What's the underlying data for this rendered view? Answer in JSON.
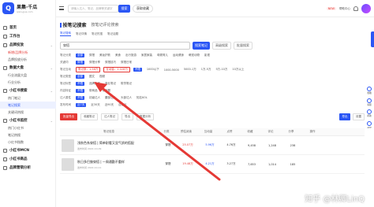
{
  "brand": {
    "name": "果集·千瓜",
    "sub": "qian-gua.com"
  },
  "sidebar": {
    "groups": [
      {
        "label": "首页",
        "items": []
      },
      {
        "label": "工作台",
        "items": []
      },
      {
        "label": "品牌投放",
        "items": [
          "新增/品牌分析",
          "品牌投放分析"
        ]
      },
      {
        "label": "数据大盘",
        "items": [
          "行业流量大盘",
          "行业分析"
        ]
      },
      {
        "label": "小红书搜索",
        "items": [
          "热门笔记",
          "笔记搜索",
          "关键词热搜"
        ]
      },
      {
        "label": "小红书监控",
        "items": [
          "热门小红书",
          "笔记热搜",
          "小红书指数"
        ]
      },
      {
        "label": "小红书MCN",
        "items": []
      },
      {
        "label": "小红书商品",
        "items": []
      },
      {
        "label": "品牌营销分析",
        "items": []
      }
    ]
  },
  "topbar": {
    "search_placeholder": "请输入达人、笔记、品牌等关键字",
    "search_btn": "搜索",
    "pill": "获取收藏",
    "right_text": "帮助中心",
    "badge": "NEW"
  },
  "main": {
    "title": "按笔记搜索",
    "tab2": "按笔记评论搜索",
    "subtabs": [
      "笔记搜索",
      "笔记详情",
      "笔记热搜",
      "笔记话题"
    ],
    "keyword": "穿搭",
    "search_btn": "搜索笔记",
    "adv_btn": "高级搜索",
    "adv_btn2": "批量搜索",
    "filters": [
      {
        "label": "笔记分类",
        "opts": [
          "全部",
          "穿搭",
          "美妆护肤",
          "美食",
          "出行旅游",
          "家居家装",
          "母婴育儿",
          "运动健身",
          "萌宠动物",
          "影视"
        ]
      },
      {
        "label": "关键词",
        "opts": [
          "穿搭",
          "穿搭分享",
          "穿搭技巧",
          "穿搭日常"
        ]
      },
      {
        "label": "笔记互动",
        "opts": [
          "不限",
          "1000以下",
          "1000-5000",
          "5000-1万",
          "1万-5万",
          "5万-10万",
          "10万以上"
        ]
      },
      {
        "label": "笔记类型",
        "opts": [
          "全部",
          "图文",
          "视频"
        ]
      },
      {
        "label": "笔记标签",
        "opts": [
          "不限",
          "品牌合作",
          "商业笔记",
          "带货笔记"
        ]
      },
      {
        "label": "内容特征",
        "opts": [
          "不限",
          "带商品",
          "带话题"
        ]
      },
      {
        "label": "达人属性",
        "opts": [
          "不限",
          "初级达人",
          "腰部达人",
          "头部达人",
          "知名KOL"
        ]
      },
      {
        "label": "发布时间",
        "opts": [
          "近7天",
          "近30天",
          "近90天",
          "自定义"
        ]
      }
    ],
    "highlight": {
      "a": "笔记数：1.56万",
      "b": "互动量：1,028万"
    },
    "actions": {
      "red": "批量导出",
      "a": "收藏笔记",
      "b": "达人笔记",
      "c": "导出",
      "d": "数据分析",
      "blue": "导出",
      "e": "设置"
    },
    "table_head": [
      "笔记信息",
      "分类",
      "预估阅读",
      "互动量",
      "点赞",
      "收藏",
      "评论",
      "分享",
      "操作"
    ],
    "rows": [
      {
        "title": "浅秋色系穿搭 | 简单耐看又显气质的搭配",
        "meta": "发布时间 2022-10-09",
        "cat": "穿搭",
        "read": "25.07万",
        "inter": "5.96万",
        "like": "4.76万",
        "fav": "9,458",
        "cmt": "1,248",
        "share": "238"
      },
      {
        "title": "秋日多巴胺穿搭 | 一周通勤不重样",
        "meta": "发布时间 2022-10-11",
        "cat": "穿搭",
        "read": "19.48万",
        "inter": "4.21万",
        "like": "3.27万",
        "fav": "7,653",
        "cmt": "1,014",
        "share": "185"
      }
    ]
  },
  "float_tools": [
    "收藏",
    "客服",
    "帮助",
    "APP"
  ],
  "watermark": "知乎 @林卿LinQ",
  "colors": {
    "accent": "#2b56f5",
    "red": "#e53935"
  }
}
